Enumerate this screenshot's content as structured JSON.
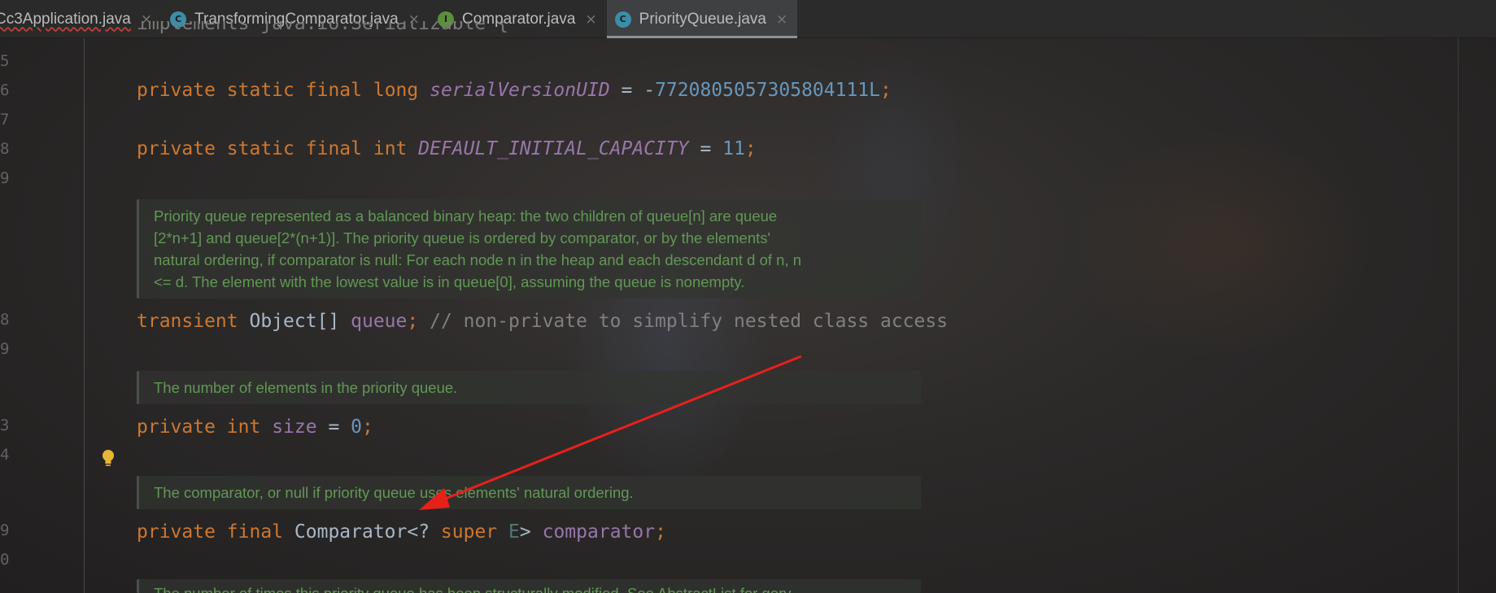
{
  "tabs": [
    {
      "label": "Cc3Application.java",
      "icon": "class-icon",
      "active": false
    },
    {
      "label": "TransformingComparator.java",
      "icon": "class-icon",
      "active": false
    },
    {
      "label": "Comparator.java",
      "icon": "interface-icon",
      "active": false
    },
    {
      "label": "PriorityQueue.java",
      "icon": "class-icon",
      "active": true
    }
  ],
  "tab_icons": {
    "class": "C",
    "interface": "I",
    "close": "×"
  },
  "gutter": [
    "5",
    "6",
    "7",
    "8",
    "9",
    "8",
    "9",
    "3",
    "4",
    "9",
    "0"
  ],
  "code": {
    "top_partial": "implements java.io.Serializable {",
    "line_serial": {
      "kw1": "private",
      "kw2": "static",
      "kw3": "final",
      "kw4": "long",
      "name": "serialVersionUID",
      "op": " = -",
      "value": "7720805057305804111L",
      "end": ";"
    },
    "line_capacity": {
      "kw1": "private",
      "kw2": "static",
      "kw3": "final",
      "kw4": "int",
      "name": "DEFAULT_INITIAL_CAPACITY",
      "op": " = ",
      "value": "11",
      "end": ";"
    },
    "line_queue": {
      "kw1": "transient",
      "type": "Object[]",
      "name": "queue",
      "end": ";",
      "comment": "// non-private to simplify nested class access"
    },
    "line_size": {
      "kw1": "private",
      "kw2": "int",
      "name": "size",
      "op": " = ",
      "value": "0",
      "end": ";"
    },
    "line_comparator": {
      "kw1": "private",
      "kw2": "final",
      "type": "Comparator<? ",
      "kw3": "super",
      "gen": "E",
      "close": ">",
      "name": "comparator",
      "end": ";"
    }
  },
  "docs": {
    "queue_doc": [
      "Priority queue represented as a balanced binary heap: the two children of queue[n] are queue",
      "[2*n+1] and queue[2*(n+1)]. The priority queue is ordered by comparator, or by the elements'",
      "natural ordering, if comparator is null: For each node n in the heap and each descendant d of n, n",
      "<= d. The element with the lowest value is in queue[0], assuming the queue is nonempty."
    ],
    "size_doc": "The number of elements in the priority queue.",
    "comparator_doc": "The comparator, or null if priority queue uses elements' natural ordering.",
    "modcount_doc_partial": "The number of times this priority queue has been structurally modified. See AbstractList for gory"
  },
  "colors": {
    "keyword": "#cc7832",
    "constant": "#9876aa",
    "number": "#6897bb",
    "doc_text": "#629755",
    "comment": "#808080",
    "arrow": "#e8201a"
  }
}
